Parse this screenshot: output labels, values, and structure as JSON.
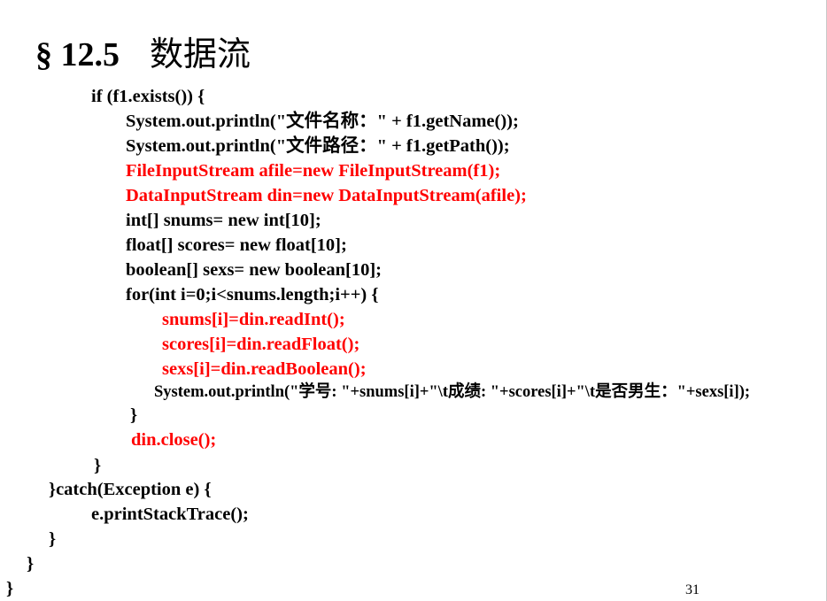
{
  "title": {
    "section": "§ 12.5",
    "chinese": "数据流"
  },
  "code": {
    "lines": [
      "if (f1.exists()) {",
      "System.out.println(\"文件名称：\" + f1.getName());",
      "System.out.println(\"文件路径：\" + f1.getPath());",
      "FileInputStream afile=new FileInputStream(f1);",
      "DataInputStream din=new DataInputStream(afile);",
      "int[] snums= new int[10];",
      "float[] scores= new float[10];",
      "boolean[] sexs= new boolean[10];",
      "for(int i=0;i<snums.length;i++) {",
      "snums[i]=din.readInt();",
      "scores[i]=din.readFloat();",
      "sexs[i]=din.readBoolean();",
      "System.out.println(\"学号: \"+snums[i]+\"\\t成绩: \"+scores[i]+\"\\t是否男生：\"+sexs[i]);",
      "}",
      "din.close();",
      "}",
      "}catch(Exception e) {",
      "e.printStackTrace();",
      "}",
      "}",
      "}"
    ]
  },
  "page_number": "31",
  "colors": {
    "highlight": "#ff0000",
    "text": "#000000"
  }
}
